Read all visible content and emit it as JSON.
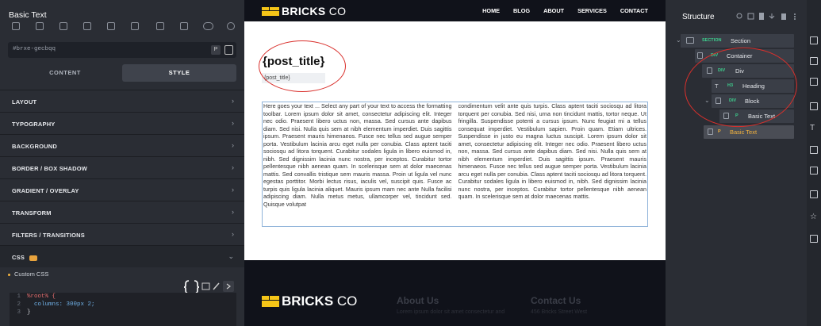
{
  "left_panel": {
    "title": "Basic Text",
    "element_id": "#brxe-gecbqq",
    "p_button": "P",
    "tabs": [
      "CONTENT",
      "STYLE"
    ],
    "active_tab": "STYLE",
    "sections": [
      "LAYOUT",
      "TYPOGRAPHY",
      "BACKGROUND",
      "BORDER / BOX SHADOW",
      "GRADIENT / OVERLAY",
      "TRANSFORM",
      "FILTERS / TRANSITIONS",
      "CSS"
    ],
    "custom_css_label": "Custom CSS",
    "code_lines": [
      {
        "num": "1",
        "text": "%root% {"
      },
      {
        "num": "2",
        "text": "  columns: 300px 2;"
      },
      {
        "num": "3",
        "text": "}"
      }
    ],
    "toolbar_icons": [
      "gear-icon",
      "pointer-icon",
      "text-icon",
      "search-icon",
      "text-cursor-icon",
      "search-icon",
      "cursor-icon",
      "sidebar-left-icon",
      "sidebar-right-icon",
      "toggle-icon",
      "settings-icon"
    ]
  },
  "canvas": {
    "header": {
      "logo_bold": "BRICKS",
      "logo_light": "CO",
      "nav": [
        "HOME",
        "BLOG",
        "ABOUT",
        "SERVICES",
        "CONTACT"
      ]
    },
    "post_title": "{post_title}",
    "post_title_input": "{post_title}",
    "basic_text_col1": "Here goes your text ... Select any part of your text to access the formatting toolbar. Lorem ipsum dolor sit amet, consectetur adipiscing elit. Integer nec odio. Praesent libero uctus non, massa. Sed cursus ante dapibus diam. Sed nisi. Nulla quis sem at nibh elementum imperdiet. Duis sagittis ipsum. Praesent mauris himenaeos. Fusce nec tellus sed augue semper porta. Vestibulum lacinia arcu eget nulla per conubia. Class aptent taciti sociosqu ad litora torquent. Curabitur sodales ligula in libero euismod in, nibh. Sed dignissim lacinia nunc nostra, per inceptos. Curabitur tortor pellentesque nibh aenean quam. In scelerisque sem at dolor maecenas mattis. Sed convallis tristique sem mauris massa. Proin ut ligula vel nunc egestas porttitor. Morbi lectus risus, iaculis vel, suscipit quis. Fusce ac turpis quis ligula lacinia aliquet. Mauris ipsum mam nec ante Nulla facilisi adipiscing diam. Nulla metus metus, ullamcorper vel, tincidunt sed. Quisque volutpat",
    "basic_text_col2": "condimentum velit ante quis turpis. Class aptent taciti sociosqu ad litora torquent per conubia. Sed nisi, urna non tincidunt mattis, tortor neque. Ut fringilla. Suspendisse potenti a cursus ipsum. Nunc feugiat mi a tellus consequat imperdiet. Vestibulum sapien. Proin quam. Etiam ultrices. Suspendisse in justo eu magna luctus suscipit. Lorem ipsum dolor sit amet, consectetur adipiscing elit. Integer nec odio. Praesent libero uctus non, massa. Sed cursus ante dapibus diam. Sed nisi. Nulla quis sem at nibh elementum imperdiet. Duis sagittis ipsum. Praesent mauris himenaeos. Fusce nec tellus sed augue semper porta. Vestibulum lacinia arcu eget nulla per conubia. Class aptent taciti sociosqu ad litora torquent. Curabitur sodales ligula in libero euismod in, nibh. Sed dignissim lacinia nunc nostra, per inceptos. Curabitur tortor pellentesque nibh aenean quam. In scelerisque sem at dolor maecenas mattis.",
    "footer": {
      "logo_bold": "BRICKS",
      "logo_light": "CO",
      "about_heading": "About Us",
      "about_sub": "Lorem ipsum dolor sit amet consectetur and",
      "contact_heading": "Contact Us",
      "contact_sub": "456 Bricks Street West"
    }
  },
  "structure": {
    "title": "Structure",
    "nodes": [
      {
        "tag": "SECTION",
        "name": "Section"
      },
      {
        "tag": "DIV",
        "name": "Container"
      },
      {
        "tag": "DIV",
        "name": "Div"
      },
      {
        "tag": "H3",
        "name": "Heading"
      },
      {
        "tag": "DIV",
        "name": "Block"
      },
      {
        "tag": "P",
        "name": "Basic Text"
      },
      {
        "tag": "P",
        "name": "Basic Text"
      }
    ]
  },
  "colors": {
    "accent_green": "#3ecf8e",
    "selected_orange": "#f3b33e",
    "logo_yellow": "#f5c518",
    "annotation_red": "#d9302c"
  }
}
